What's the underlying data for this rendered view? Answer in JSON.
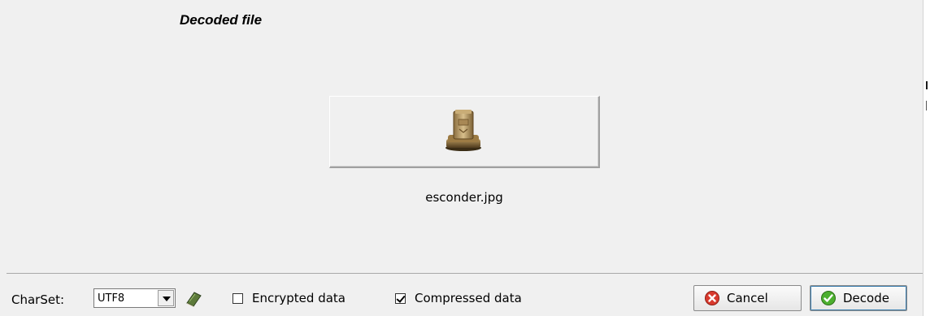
{
  "section": {
    "title": "Decoded file"
  },
  "file": {
    "name": "esconder.jpg",
    "icon": "archive-cabinet-icon"
  },
  "bottom": {
    "charset_label": "CharSet:",
    "charset_value": "UTF8",
    "encrypted_label": "Encrypted data",
    "encrypted_checked": false,
    "compressed_label": "Compressed data",
    "compressed_checked": true,
    "cancel_label": "Cancel",
    "decode_label": "Decode"
  },
  "colors": {
    "cancel_icon": "#d83a2e",
    "decode_icon": "#4caf2f",
    "book_icon": "#5c7a3a"
  }
}
